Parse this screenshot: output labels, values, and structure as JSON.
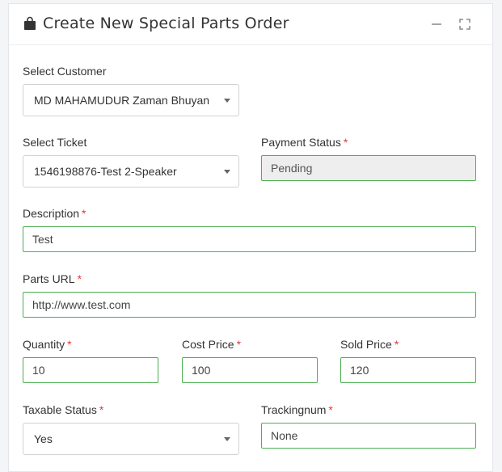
{
  "panel": {
    "title": "Create New Special Parts Order",
    "icons": {
      "title_icon": "shopping-bag-icon",
      "minimize": "minus-icon",
      "expand": "expand-icon"
    }
  },
  "form": {
    "required_mark": "*",
    "customer": {
      "label": "Select Customer",
      "value": "MD MAHAMUDUR Zaman Bhuyan"
    },
    "ticket": {
      "label": "Select Ticket",
      "value": "1546198876-Test 2-Speaker"
    },
    "payment_status": {
      "label": "Payment Status",
      "value": "Pending"
    },
    "description": {
      "label": "Description",
      "value": "Test"
    },
    "parts_url": {
      "label": "Parts URL",
      "value": "http://www.test.com"
    },
    "quantity": {
      "label": "Quantity",
      "value": "10"
    },
    "cost_price": {
      "label": "Cost Price",
      "value": "100"
    },
    "sold_price": {
      "label": "Sold Price",
      "value": "120"
    },
    "taxable_status": {
      "label": "Taxable Status",
      "value": "Yes"
    },
    "trackingnum": {
      "label": "Trackingnum",
      "value": "None"
    }
  },
  "colors": {
    "valid_border": "#4caf50",
    "required": "#e53935",
    "readonly_bg": "#eeeeee"
  }
}
